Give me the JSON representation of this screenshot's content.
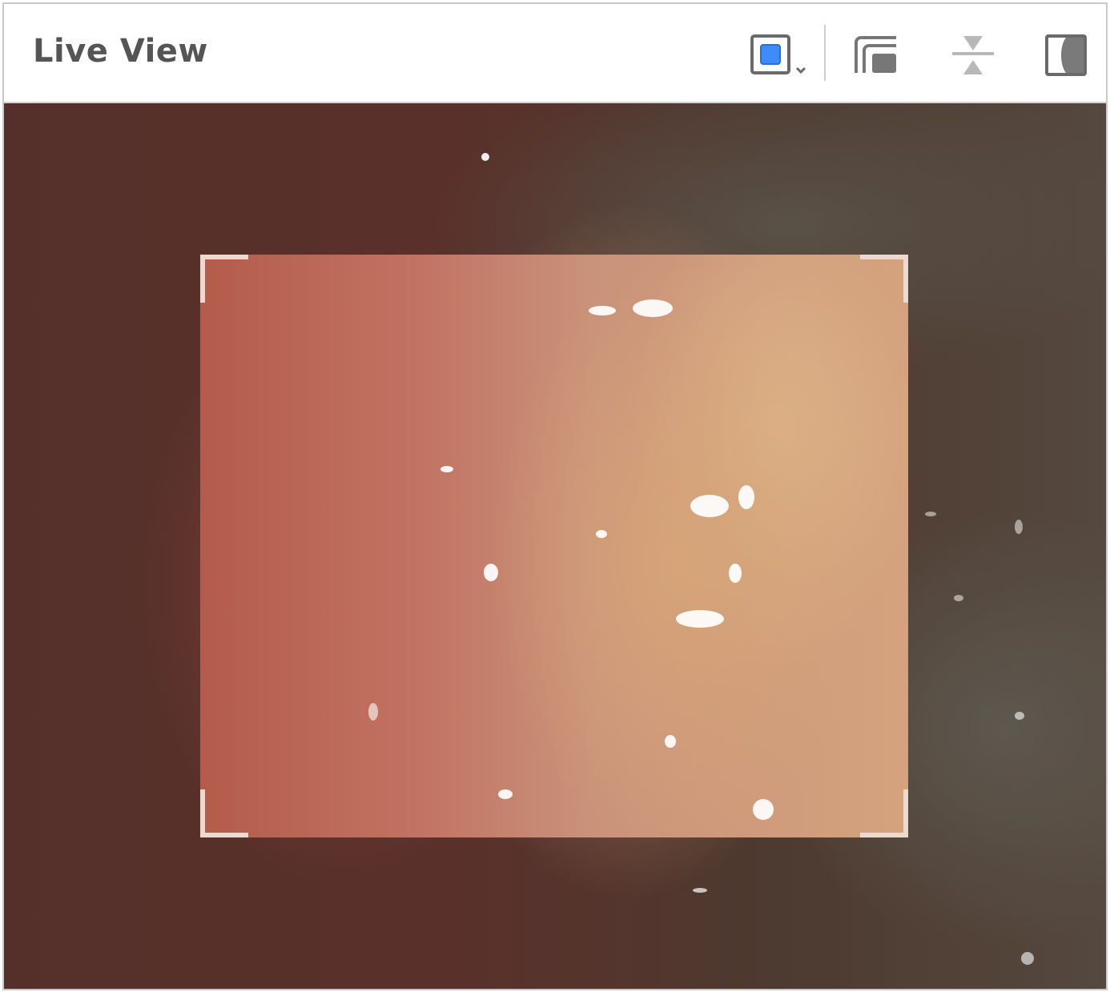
{
  "header": {
    "title": "Live View"
  },
  "toolbar": {
    "buttons": [
      {
        "name": "view-mode",
        "icon": "square-select-icon",
        "has_dropdown": true
      },
      {
        "name": "layers",
        "icon": "layers-icon"
      },
      {
        "name": "center",
        "icon": "align-center-icon"
      },
      {
        "name": "contrast",
        "icon": "contrast-icon"
      }
    ]
  },
  "colors": {
    "accent": "#3d8bfd",
    "title_text": "#555555",
    "icon_gray": "#777777"
  }
}
